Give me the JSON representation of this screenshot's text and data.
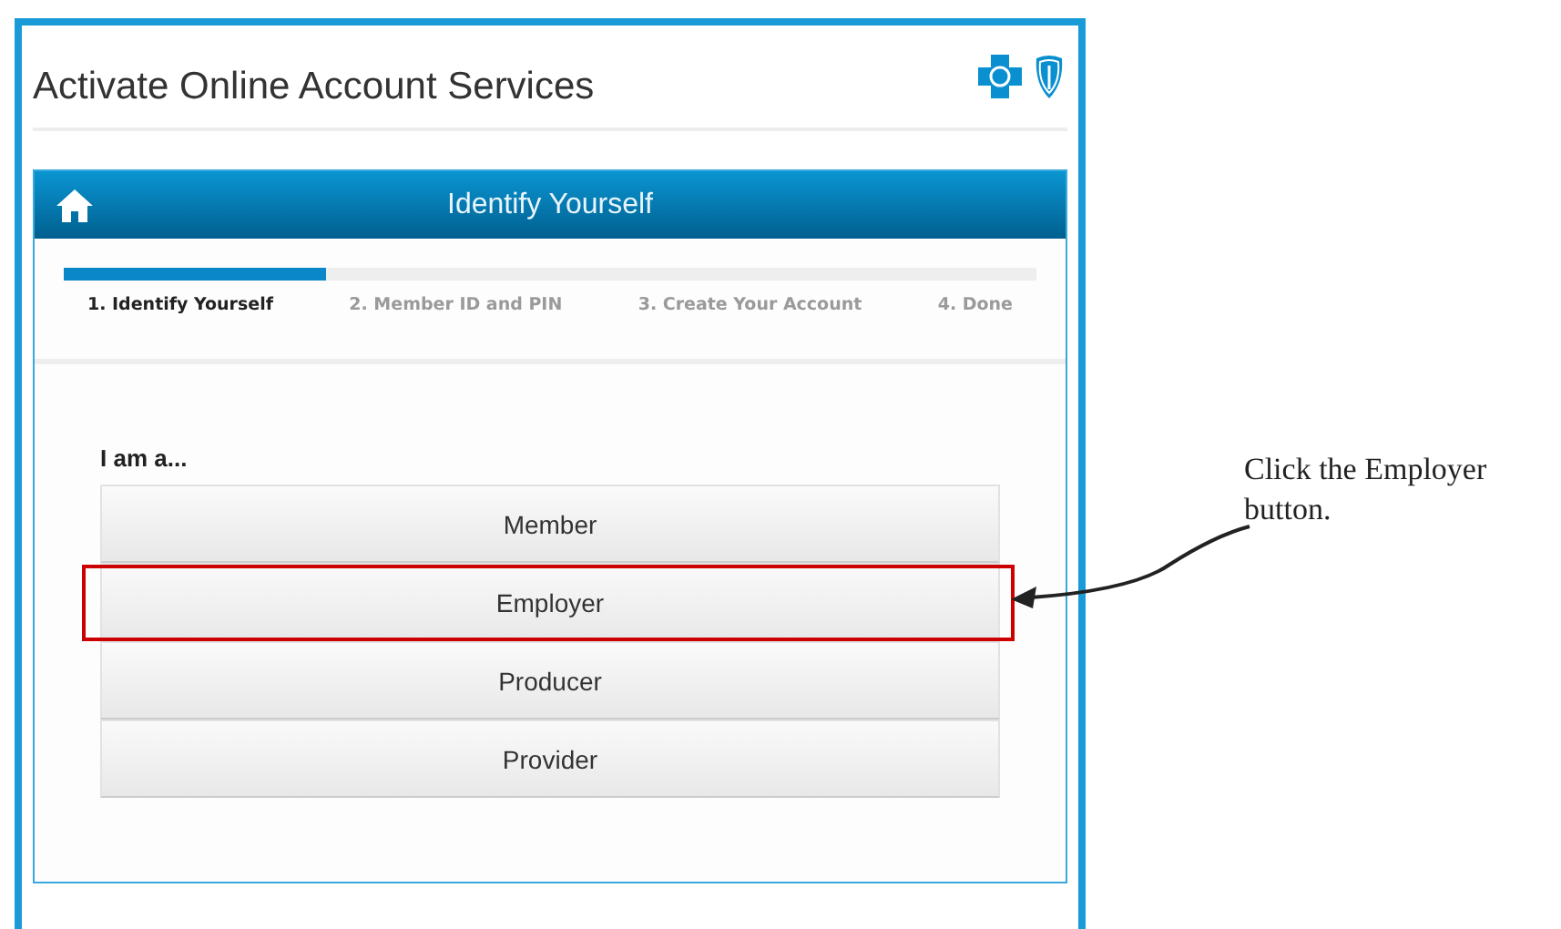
{
  "page": {
    "title": "Activate Online Account Services"
  },
  "panel": {
    "title": "Identify Yourself",
    "progress": {
      "level": 0.27
    },
    "steps": [
      {
        "label": "1. Identify Yourself",
        "selected": true
      },
      {
        "label": "2. Member ID and PIN",
        "selected": false
      },
      {
        "label": "3. Create Your Account",
        "selected": false
      },
      {
        "label": "4. Done",
        "selected": false
      }
    ],
    "prompt": "I am a...",
    "options": [
      {
        "label": "Member",
        "highlighted": false
      },
      {
        "label": "Employer",
        "highlighted": true
      },
      {
        "label": "Producer",
        "highlighted": false
      },
      {
        "label": "Provider",
        "highlighted": false
      }
    ]
  },
  "callout": {
    "text": "Click the Employer button."
  }
}
